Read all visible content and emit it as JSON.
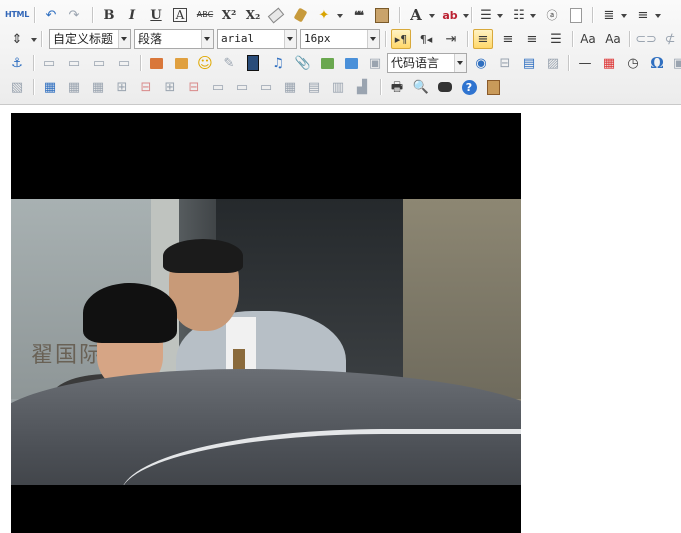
{
  "toolbar": {
    "html_label": "HTML",
    "row1": {
      "undo": "↶",
      "redo": "↷",
      "bold": "B",
      "italic": "I",
      "underline": "U",
      "border": "A",
      "strikethrough": "ABC",
      "superscript": "X²",
      "subscript": "X₂",
      "quote": "❝❝",
      "font_color": "A",
      "highlight": "ab"
    },
    "row2": {
      "custom_heading": "自定义标题",
      "paragraph": "段落",
      "font_family": "arial",
      "font_size": "16px"
    },
    "row3": {
      "code_language": "代码语言",
      "special_char": "Ω"
    }
  },
  "colors": {
    "toolbar_bg": "#ececec",
    "active_button": "#ffd86b",
    "icon_blue": "#2f6fc0"
  },
  "editor": {
    "video": {
      "sign_text": "翟国际"
    }
  }
}
